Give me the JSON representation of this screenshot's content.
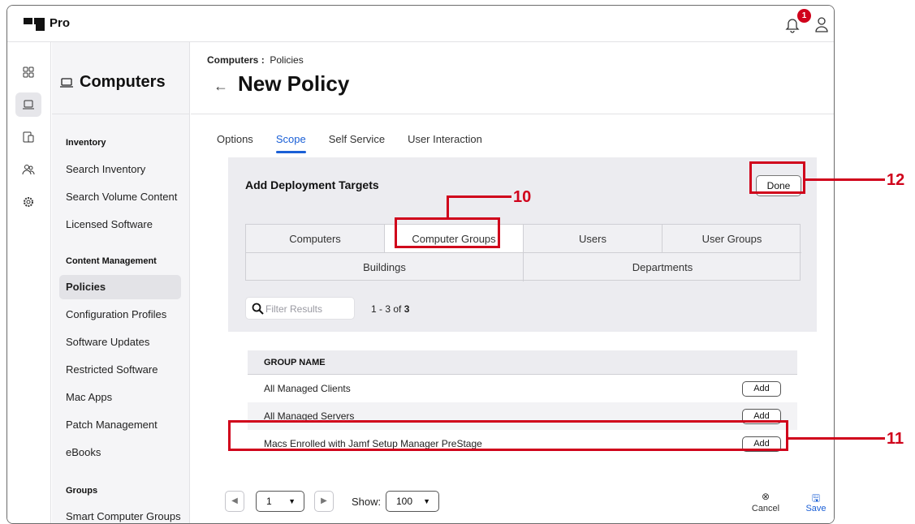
{
  "app": {
    "name": "Pro",
    "notification_count": "1"
  },
  "sidebar": {
    "title": "Computers",
    "sections": [
      {
        "heading": "Inventory",
        "items": [
          "Search Inventory",
          "Search Volume Content",
          "Licensed Software"
        ]
      },
      {
        "heading": "Content Management",
        "items": [
          "Policies",
          "Configuration Profiles",
          "Software Updates",
          "Restricted Software",
          "Mac Apps",
          "Patch Management",
          "eBooks"
        ]
      },
      {
        "heading": "Groups",
        "items": [
          "Smart Computer Groups"
        ]
      }
    ],
    "active_item": "Policies"
  },
  "breadcrumb": {
    "section": "Computers",
    "separator": ":",
    "page": "Policies"
  },
  "page_title": "New Policy",
  "tabs": [
    "Options",
    "Scope",
    "Self Service",
    "User Interaction"
  ],
  "active_tab": "Scope",
  "targets_panel": {
    "title": "Add Deployment Targets",
    "done_label": "Done",
    "segments_row1": [
      "Computers",
      "Computer Groups",
      "Users",
      "User Groups"
    ],
    "segments_row2": [
      "Buildings",
      "Departments"
    ],
    "selected_segment": "Computer Groups",
    "filter_placeholder": "Filter Results",
    "count_prefix": "1 - 3 of ",
    "count_total": "3"
  },
  "table": {
    "header": "GROUP NAME",
    "rows": [
      {
        "name": "All Managed Clients",
        "action": "Add"
      },
      {
        "name": "All Managed Servers",
        "action": "Add"
      },
      {
        "name": "Macs Enrolled with Jamf Setup Manager PreStage",
        "action": "Add"
      }
    ]
  },
  "footer": {
    "page": "1",
    "show_label": "Show:",
    "page_size": "100",
    "cancel_label": "Cancel",
    "save_label": "Save"
  },
  "annotations": {
    "a10": "10",
    "a11": "11",
    "a12": "12",
    "color": "#d0021b"
  },
  "colors": {
    "accent": "#1a5fd6",
    "annotation": "#d0021b"
  },
  "icons": [
    "logo-icon",
    "bell-icon",
    "user-icon",
    "dashboard-icon",
    "laptop-icon",
    "devices-icon",
    "users-icon",
    "settings-icon",
    "search-icon",
    "cancel-icon",
    "save-icon"
  ]
}
